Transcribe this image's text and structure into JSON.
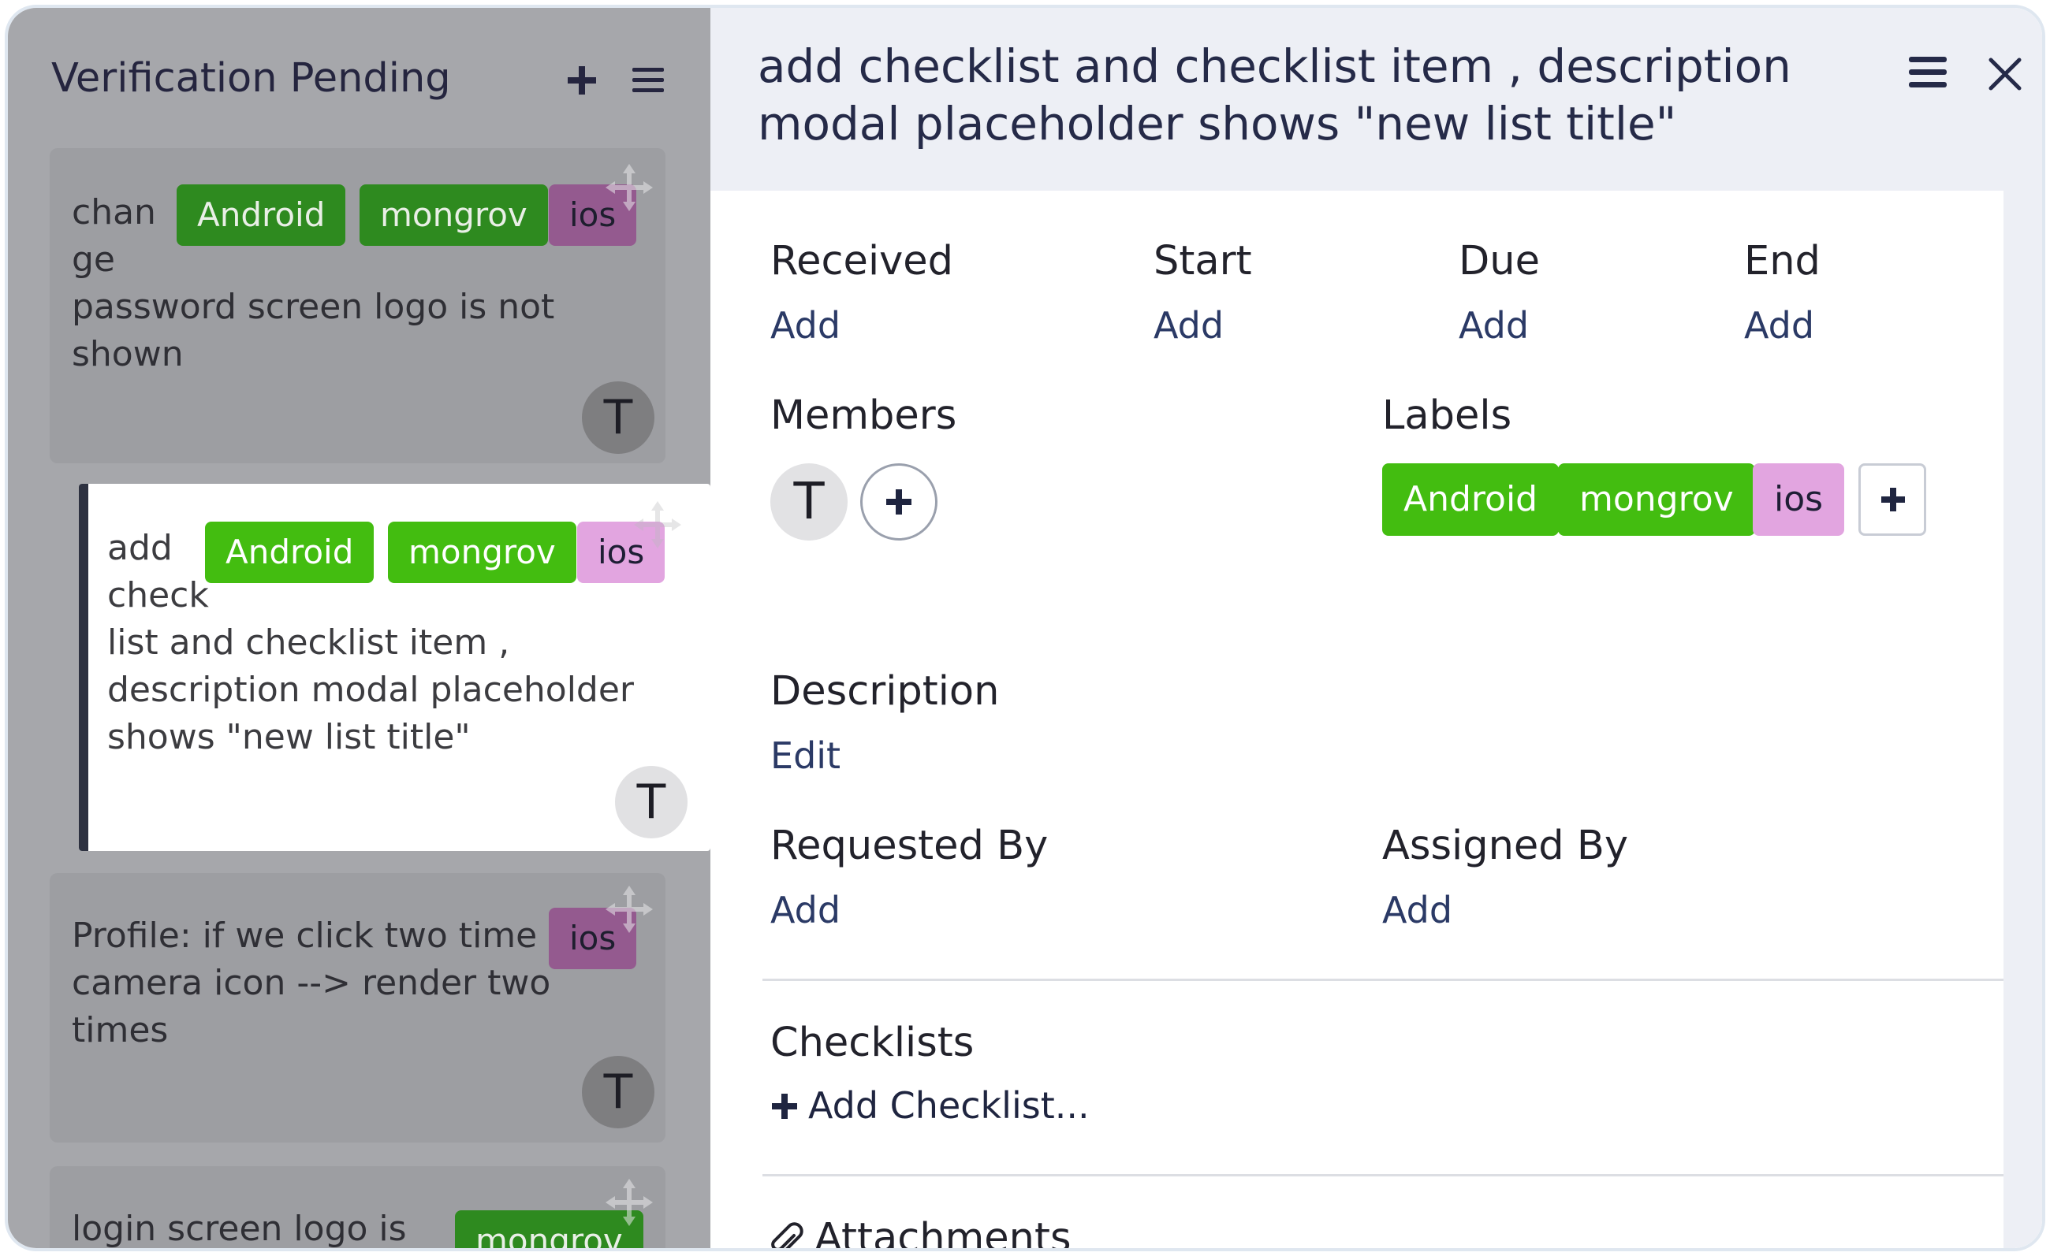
{
  "column": {
    "title": "Verification Pending",
    "icons": {
      "add": "plus-icon",
      "menu": "hamburger-menu-icon",
      "move": "move-arrows-icon"
    }
  },
  "cards": [
    {
      "text": "chan\nge\npassword screen logo is not\nshown",
      "labels": [
        "Android",
        "mongrov",
        "ios"
      ],
      "avatar": "T"
    },
    {
      "text": "add\ncheck\nlist and checklist item ,\ndescription modal placeholder\nshows \"new list title\"",
      "labels": [
        "Android",
        "mongrov",
        "ios"
      ],
      "avatar": "T"
    },
    {
      "text": "Profile: if we click two time\ncamera icon --> render two\ntimes",
      "labels": [
        "ios"
      ],
      "avatar": "T"
    },
    {
      "text": "login screen logo is",
      "labels": [
        "mongrov"
      ]
    }
  ],
  "modal": {
    "title": "add checklist and checklist item , description modal placeholder shows \"new list title\"",
    "dates": [
      {
        "label": "Received",
        "action": "Add"
      },
      {
        "label": "Start",
        "action": "Add"
      },
      {
        "label": "Due",
        "action": "Add"
      },
      {
        "label": "End",
        "action": "Add"
      }
    ],
    "members": {
      "label": "Members",
      "avatar": "T"
    },
    "labels": {
      "label": "Labels",
      "items": [
        "Android",
        "mongrov",
        "ios"
      ]
    },
    "description": {
      "label": "Description",
      "action": "Edit"
    },
    "requested_by": {
      "label": "Requested By",
      "action": "Add"
    },
    "assigned_by": {
      "label": "Assigned By",
      "action": "Add"
    },
    "checklists": {
      "label": "Checklists",
      "action": "Add Checklist..."
    },
    "attachments": {
      "label": "Attachments"
    }
  },
  "colors": {
    "label_green": "#43bd10",
    "label_pink": "#e2a5e0",
    "title_navy": "#252a48",
    "header_bg": "#edeff5"
  }
}
